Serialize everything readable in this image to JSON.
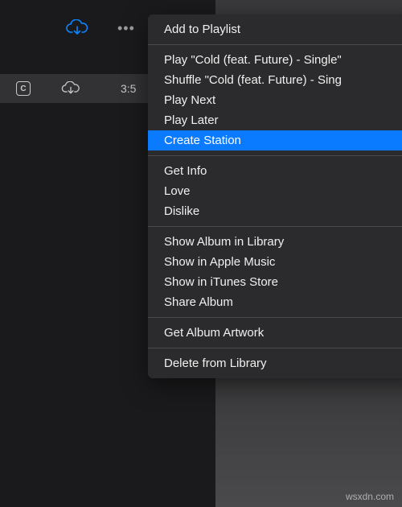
{
  "track": {
    "badge_letter": "C",
    "duration": "3:5"
  },
  "menu": {
    "groups": [
      [
        {
          "label": "Add to Playlist",
          "highlight": false
        }
      ],
      [
        {
          "label": "Play \"Cold (feat. Future) - Single\"",
          "highlight": false
        },
        {
          "label": "Shuffle \"Cold (feat. Future) - Sing",
          "highlight": false
        },
        {
          "label": "Play Next",
          "highlight": false
        },
        {
          "label": "Play Later",
          "highlight": false
        },
        {
          "label": "Create Station",
          "highlight": true
        }
      ],
      [
        {
          "label": "Get Info",
          "highlight": false
        },
        {
          "label": "Love",
          "highlight": false
        },
        {
          "label": "Dislike",
          "highlight": false
        }
      ],
      [
        {
          "label": "Show Album in Library",
          "highlight": false
        },
        {
          "label": "Show in Apple Music",
          "highlight": false
        },
        {
          "label": "Show in iTunes Store",
          "highlight": false
        },
        {
          "label": "Share Album",
          "highlight": false
        }
      ],
      [
        {
          "label": "Get Album Artwork",
          "highlight": false
        }
      ],
      [
        {
          "label": "Delete from Library",
          "highlight": false
        }
      ]
    ]
  },
  "watermark": "wsxdn.com"
}
